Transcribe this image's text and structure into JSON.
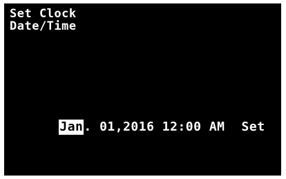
{
  "header": {
    "line1": "Set Clock",
    "line2": "Date/Time"
  },
  "datetime": {
    "month": "Jan",
    "sep1": ".",
    "day": "01",
    "sep2": ",",
    "year": "2016",
    "time": "12:00",
    "ampm": "AM",
    "set_label": "Set"
  },
  "colors": {
    "screen_bg": "#000000",
    "text": "#ffffff",
    "highlight_bg": "#ffffff",
    "highlight_text": "#000000"
  }
}
